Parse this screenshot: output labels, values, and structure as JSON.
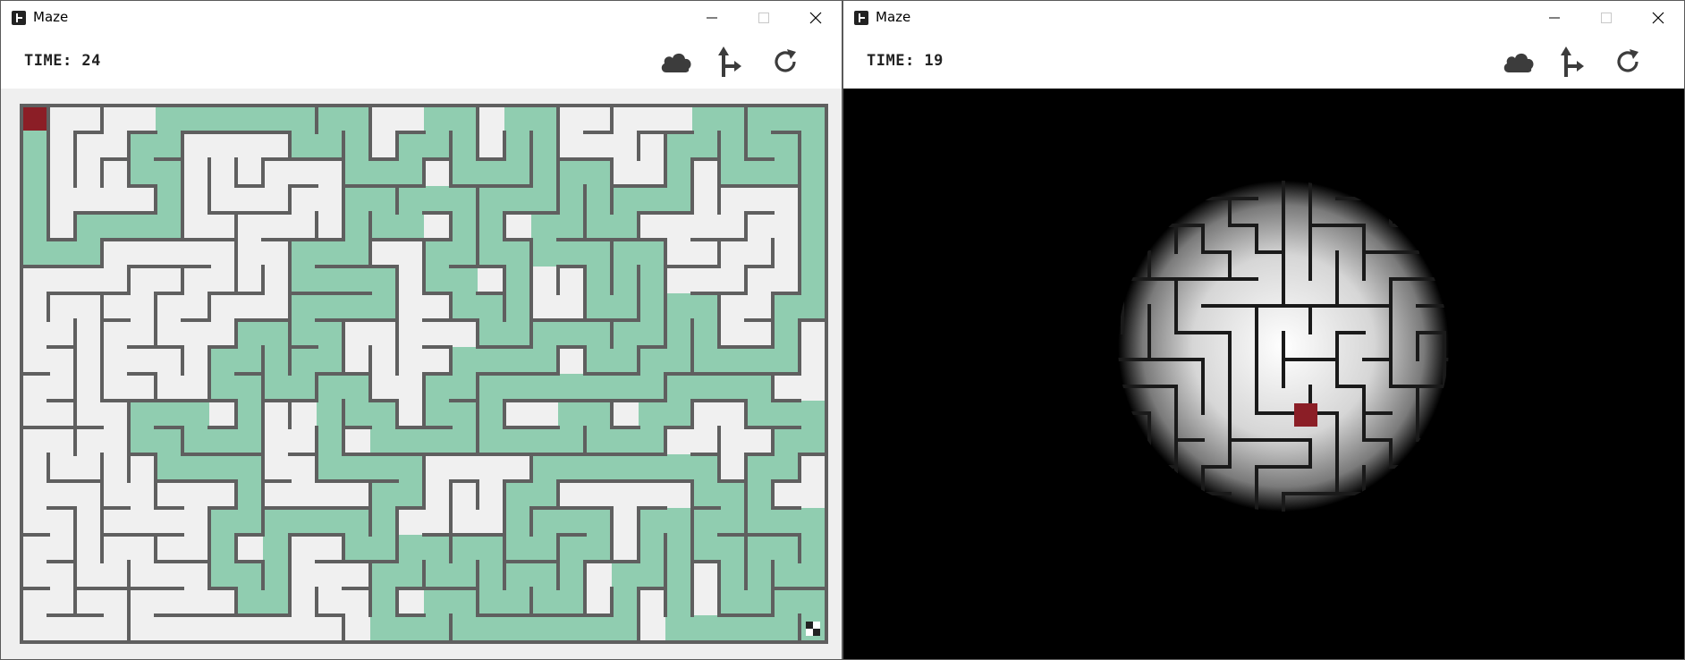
{
  "windows": [
    {
      "title": "Maze",
      "time_label": "TIME: 24",
      "mode": "solution-shown"
    },
    {
      "title": "Maze",
      "time_label": "TIME: 19",
      "mode": "dark-flashlight"
    }
  ],
  "toolbar_icons": [
    "cloud-icon",
    "path-hint-icon",
    "restart-icon"
  ],
  "window_controls": [
    "minimize-icon",
    "maximize-icon",
    "close-icon"
  ],
  "colors": {
    "wall": "#5f5f5f",
    "floor": "#f0f0f0",
    "solution_path": "#90cdb0",
    "player": "#8b1e26",
    "goal": "#222222",
    "dark_bg": "#000000"
  },
  "maze": {
    "cols": 30,
    "rows": 20,
    "start": [
      0,
      0
    ],
    "goal": [
      29,
      19
    ]
  }
}
